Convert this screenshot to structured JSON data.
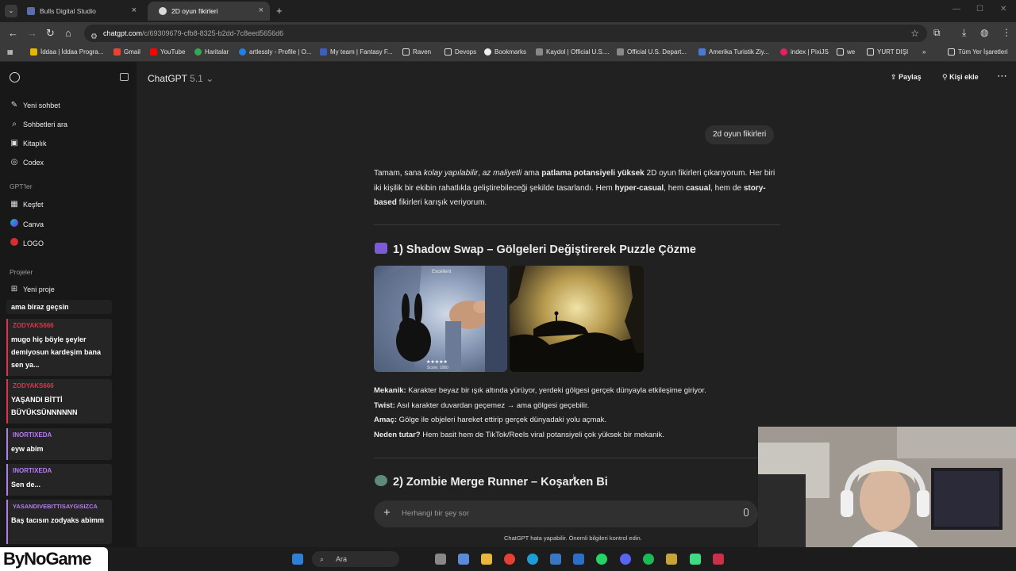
{
  "browser": {
    "tabs": [
      {
        "title": "Bulls Digital Studio",
        "active": false
      },
      {
        "title": "2D oyun fikirleri",
        "active": true
      }
    ],
    "url_host": "chatgpt.com",
    "url_path": "/c/69309679-cfb8-8325-b2dd-7c8eed5656d6",
    "bookmarks": [
      "İddaa | İddaa Progra...",
      "Gmail",
      "YouTube",
      "Haritalar",
      "artlessly - Profile | O...",
      "My team | Fantasy F...",
      "Raven",
      "Devops",
      "Bookmarks",
      "Kaydol | Official U.S....",
      "Official U.S. Depart...",
      "Amerika Turistik Ziy...",
      "index | PixiJS",
      "we",
      "YURT DIŞI"
    ],
    "all_bookmarks": "Tüm Yer İşaretleri"
  },
  "sidebar": {
    "items": [
      "Yeni sohbet",
      "Sohbetleri ara",
      "Kitaplık",
      "Codex"
    ],
    "gpts_heading": "GPT'ler",
    "gpts": [
      "Keşfet",
      "Canva",
      "LOGO"
    ],
    "projects_heading": "Projeler",
    "new_project": "Yeni proje"
  },
  "stream_chat": [
    {
      "user": "",
      "message": "ama biraz geçsin",
      "color": "#ffffff"
    },
    {
      "user": "ZODYAKS666",
      "message": "mugo hiç böyle şeyler demiyosun kardeşim bana sen ya...",
      "color": "#e0324a"
    },
    {
      "user": "ZODYAKS666",
      "message": "YAŞANDI BİTTİ BÜYÜKSÜNNNNNN",
      "color": "#e0324a"
    },
    {
      "user": "INORTIXEDA",
      "message": "eyw abim",
      "color": "#b57cf0"
    },
    {
      "user": "INORTIXEDA",
      "message": "Sen de...",
      "color": "#b57cf0"
    },
    {
      "user": "YASANDIVEBITTISAYGISIZCA",
      "message": "Baş tacısın zodyaks abimm",
      "color": "#b57cf0"
    }
  ],
  "header": {
    "model_name": "ChatGPT",
    "model_version": "5.1",
    "share_label": "Paylaş",
    "add_person_label": "Kişi ekle"
  },
  "conversation": {
    "user_message": "2d oyun fikirleri",
    "intro_parts": {
      "p1": "Tamam, sana ",
      "em1": "kolay yapılabilir",
      "p2": ", ",
      "em2": "az maliyetli",
      "p3": " ama ",
      "b1": "patlama potansiyeli yüksek",
      "p4": " 2D oyun fikirleri çıkarıyorum. Her biri iki kişilik bir ekibin rahatlıkla geliştirebileceği şekilde tasarlandı. Hem ",
      "b2": "hyper-casual",
      "p5": ", hem ",
      "b3": "casual",
      "p6": ", hem de ",
      "b4": "story-based",
      "p7": " fikirleri karışık veriyorum."
    },
    "idea1_title": "1) Shadow Swap – Gölgeleri Değiştirerek Puzzle Çözme",
    "image1_label": "Excellent",
    "image1_score": "Score: 1000",
    "details": [
      {
        "label": "Mekanik:",
        "text": " Karakter beyaz bir ışık altında yürüyor, yerdeki gölgesi gerçek dünyayla etkileşime giriyor."
      },
      {
        "label": "Twist:",
        "text": " Asıl karakter duvardan geçemez → ama gölgesi geçebilir."
      },
      {
        "label": "Amaç:",
        "text": " Gölge ile objeleri hareket ettirip gerçek dünyadaki yolu açmak."
      },
      {
        "label": "Neden tutar?",
        "text": " Hem basit hem de TikTok/Reels viral potansiyeli çok yüksek bir mekanik."
      }
    ],
    "idea2_title": "2) Zombie Merge Runner – Koşarken Bi"
  },
  "composer": {
    "placeholder": "Herhangi bir şey sor",
    "disclaimer": "ChatGPT hata yapabilir. Önemli bilgileri kontrol edin."
  },
  "taskbar": {
    "search_label": "Ara"
  },
  "watermark": "ByNoGame"
}
